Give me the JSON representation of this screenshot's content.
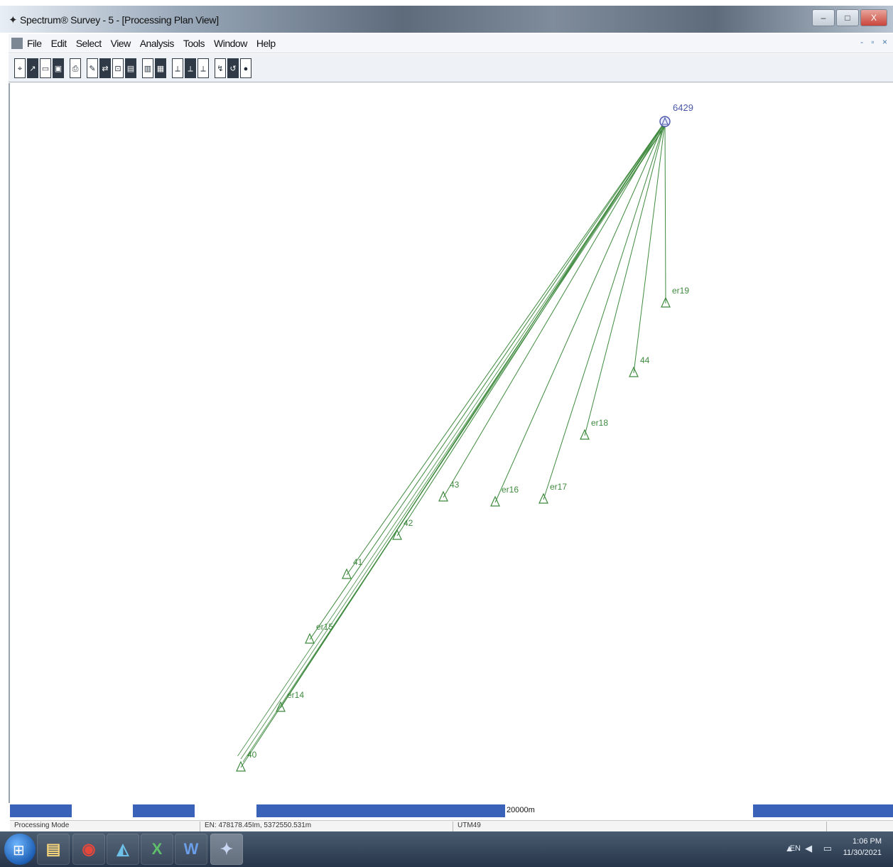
{
  "window": {
    "title": "Spectrum® Survey - 5 - [Processing Plan View]",
    "buttons": {
      "minimize": "–",
      "maximize": "□",
      "close": "X"
    }
  },
  "menu": {
    "items": [
      "File",
      "Edit",
      "Select",
      "View",
      "Analysis",
      "Tools",
      "Window",
      "Help"
    ],
    "mdi_buttons": "- ▫ ×"
  },
  "toolbar": {
    "groups": [
      [
        "⌖",
        "↗",
        "▭",
        "▣"
      ],
      [
        "⎙"
      ],
      [
        "✎",
        "⇄",
        "⊡",
        "▤"
      ],
      [
        "▥",
        "▦"
      ],
      [
        "⟂",
        "⟂",
        "⟂"
      ],
      [
        "↯",
        "↺",
        "●"
      ]
    ]
  },
  "plan": {
    "base": {
      "label": "6429"
    },
    "stations": [
      {
        "label": "er19"
      },
      {
        "label": "44"
      },
      {
        "label": "er18"
      },
      {
        "label": "er17"
      },
      {
        "label": "er16"
      },
      {
        "label": "43"
      },
      {
        "label": "42"
      },
      {
        "label": "41"
      },
      {
        "label": "er15"
      },
      {
        "label": "er14"
      },
      {
        "label": "40"
      }
    ],
    "line_color": "#3f8a3f",
    "label_color": "#3f8a3f",
    "base_color": "#4a56a8"
  },
  "scalebar": {
    "label": "20000m",
    "color": "#3a62b8"
  },
  "status": {
    "mode": "Processing Mode",
    "coords": "EN: 478178.45Im, 5372550.531m",
    "projection": "UTM49"
  },
  "taskbar": {
    "apps": [
      "explorer",
      "chrome",
      "spectrum",
      "excel",
      "word",
      "survey"
    ],
    "tray_lang": "EN",
    "tray_icons": "▲ ◀ ▭",
    "time": "1:06 PM",
    "date": "11/30/2021"
  }
}
